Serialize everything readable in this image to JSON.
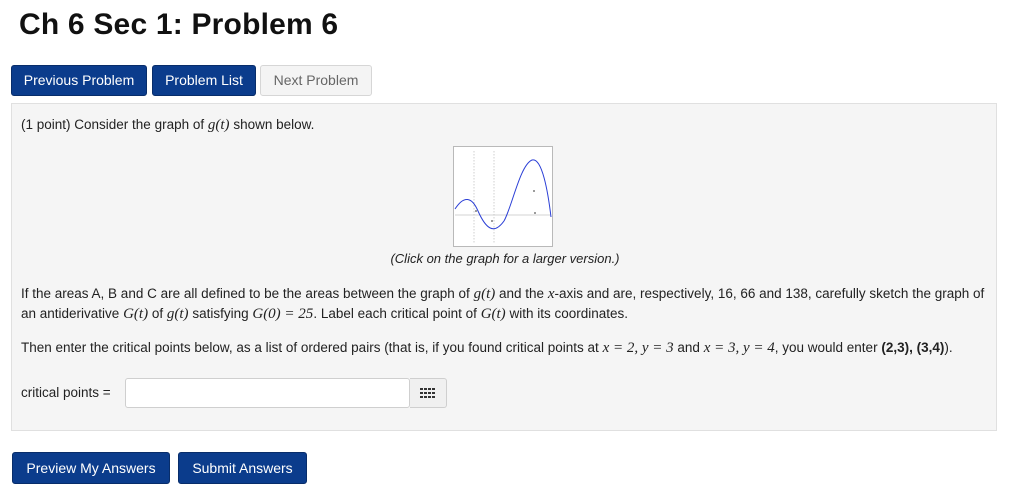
{
  "page": {
    "title": "Ch 6 Sec 1: Problem 6"
  },
  "nav": {
    "previous": "Previous Problem",
    "list": "Problem List",
    "next": "Next Problem"
  },
  "problem": {
    "intro_prefix": "(1 point) Consider the graph of",
    "intro_func": "g(t)",
    "intro_suffix": "shown below.",
    "caption": "(Click on the graph for a larger version.)",
    "p1": {
      "a": "If the areas A, B and C are all defined to be the areas between the graph of",
      "g": "g(t)",
      "b": "and the",
      "x": "x",
      "c": "-axis and are, respectively, 16, 66 and 138, carefully sketch the graph of an antiderivative",
      "G": "G(t)",
      "d": "of",
      "g2": "g(t)",
      "e": "satisfying",
      "cond": "G(0) = 25",
      "f": ". Label each critical point of",
      "G2": "G(t)",
      "g3": "with its coordinates."
    },
    "p2": {
      "a": "Then enter the critical points below, as a list of ordered pairs (that is, if you found critical points at",
      "m1": "x = 2, y = 3",
      "b": "and",
      "m2": "x = 3, y = 4",
      "c": ", you would enter",
      "ex": "(2,3), (3,4)",
      "d": ")."
    },
    "answer_label": "critical points =",
    "answer_value": ""
  },
  "actions": {
    "preview": "Preview My Answers",
    "submit": "Submit Answers"
  },
  "icons": {
    "palette": "grid-keypad-icon"
  },
  "colors": {
    "primary": "#0b3c8c",
    "curve": "#2b3fd6"
  }
}
